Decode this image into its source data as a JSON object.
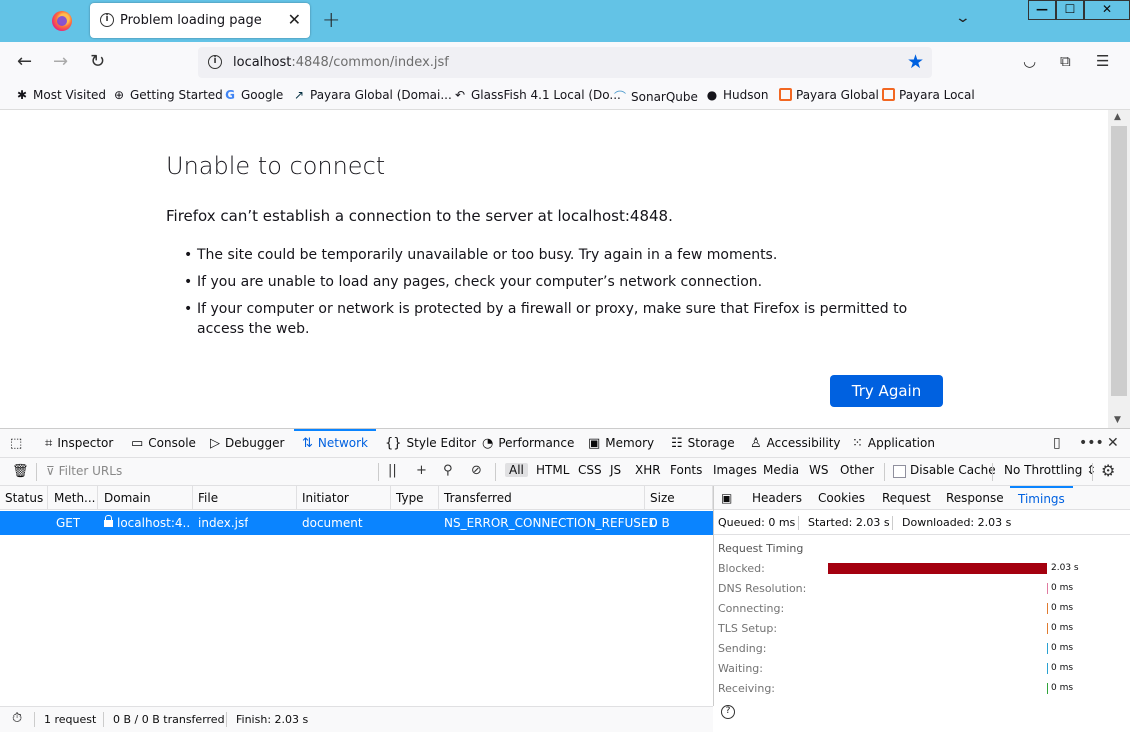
{
  "browser": {
    "tab_title": "Problem loading page",
    "url_host": "localhost",
    "url_path": ":4848/common/index.jsf"
  },
  "bookmarks": [
    {
      "label": "Most Visited",
      "icon": "gear-icon"
    },
    {
      "label": "Getting Started",
      "icon": "globe-icon"
    },
    {
      "label": "Google",
      "icon": "google-icon"
    },
    {
      "label": "Payara Global (Domai...",
      "icon": "payara-fish-icon"
    },
    {
      "label": "GlassFish 4.1 Local (Do...",
      "icon": "glassfish-icon"
    },
    {
      "label": "SonarQube",
      "icon": "sonarqube-icon"
    },
    {
      "label": "Hudson",
      "icon": "hudson-icon"
    },
    {
      "label": "Payara Global",
      "icon": "payara-icon"
    },
    {
      "label": "Payara Local",
      "icon": "payara-icon"
    }
  ],
  "error_page": {
    "title": "Unable to connect",
    "description": "Firefox can’t establish a connection to the server at localhost:4848.",
    "bullets": [
      "The site could be temporarily unavailable or too busy. Try again in a few moments.",
      "If you are unable to load any pages, check your computer’s network connection.",
      "If your computer or network is protected by a firewall or proxy, make sure that Firefox is permitted to access the web."
    ],
    "button": "Try Again"
  },
  "devtools": {
    "tabs": [
      "Inspector",
      "Console",
      "Debugger",
      "Network",
      "Style Editor",
      "Performance",
      "Memory",
      "Storage",
      "Accessibility",
      "Application"
    ],
    "active_tab": "Network",
    "filter_placeholder": "Filter URLs",
    "type_filters": [
      "All",
      "HTML",
      "CSS",
      "JS",
      "XHR",
      "Fonts",
      "Images",
      "Media",
      "WS",
      "Other"
    ],
    "disable_cache": "Disable Cache",
    "throttling": "No Throttling ⇕",
    "columns": [
      "Status",
      "Meth...",
      "Domain",
      "File",
      "Initiator",
      "Type",
      "Transferred",
      "Size"
    ],
    "request": {
      "status": "",
      "method": "GET",
      "domain": "localhost:4...",
      "file": "index.jsf",
      "initiator": "document",
      "type": "",
      "transferred": "NS_ERROR_CONNECTION_REFUSED",
      "size": "0 B"
    },
    "side_tabs": [
      "Headers",
      "Cookies",
      "Request",
      "Response",
      "Timings"
    ],
    "side_active": "Timings",
    "summary": {
      "queued": "Queued: 0 ms",
      "started": "Started: 2.03 s",
      "downloaded": "Downloaded: 2.03 s"
    },
    "timing_title": "Request Timing",
    "timings": [
      {
        "label": "Blocked:",
        "value": "2.03 s",
        "fraction": 1.0,
        "color": "#a4000f"
      },
      {
        "label": "DNS Resolution:",
        "value": "0 ms",
        "fraction": 0,
        "color": "#e07ba0"
      },
      {
        "label": "Connecting:",
        "value": "0 ms",
        "fraction": 0,
        "color": "#e07b30"
      },
      {
        "label": "TLS Setup:",
        "value": "0 ms",
        "fraction": 0,
        "color": "#e07b30"
      },
      {
        "label": "Sending:",
        "value": "0 ms",
        "fraction": 0,
        "color": "#2aa1d1"
      },
      {
        "label": "Waiting:",
        "value": "0 ms",
        "fraction": 0,
        "color": "#2aa1d1"
      },
      {
        "label": "Receiving:",
        "value": "0 ms",
        "fraction": 0,
        "color": "#2fa43b"
      }
    ],
    "status": {
      "requests": "1 request",
      "transferred": "0 B / 0 B transferred",
      "finish": "Finish: 2.03 s"
    }
  }
}
